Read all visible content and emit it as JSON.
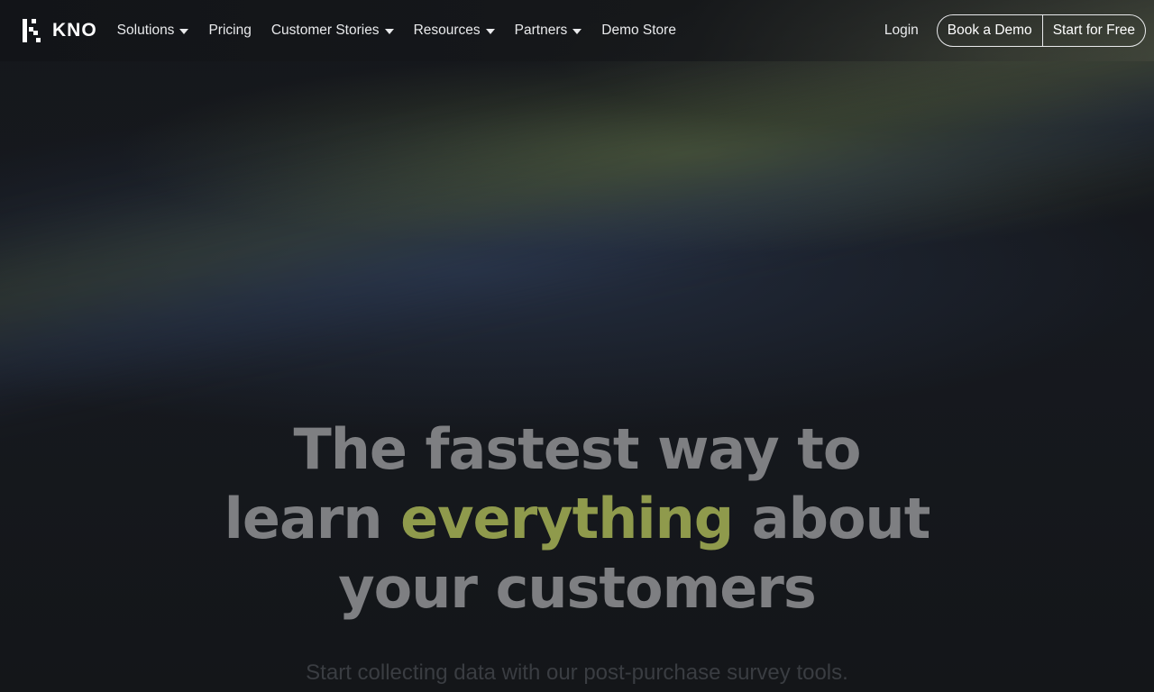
{
  "brand": {
    "name": "KNO"
  },
  "nav": {
    "items": [
      {
        "label": "Solutions",
        "dropdown": true
      },
      {
        "label": "Pricing",
        "dropdown": false
      },
      {
        "label": "Customer Stories",
        "dropdown": true
      },
      {
        "label": "Resources",
        "dropdown": true
      },
      {
        "label": "Partners",
        "dropdown": true
      },
      {
        "label": "Demo Store",
        "dropdown": false
      }
    ],
    "login": "Login",
    "book_demo": "Book a Demo",
    "start_free": "Start for Free"
  },
  "hero": {
    "line1": "The fastest way to",
    "line2_pre": "learn ",
    "line2_accent": "everything",
    "line2_post": " about",
    "line3": "your customers",
    "subtitle": "Start collecting data with our post-purchase survey tools."
  },
  "colors": {
    "background": "#121418",
    "headline": "#7e7f82",
    "accent": "#8f9a4c",
    "nav_text": "#e9eaec"
  }
}
